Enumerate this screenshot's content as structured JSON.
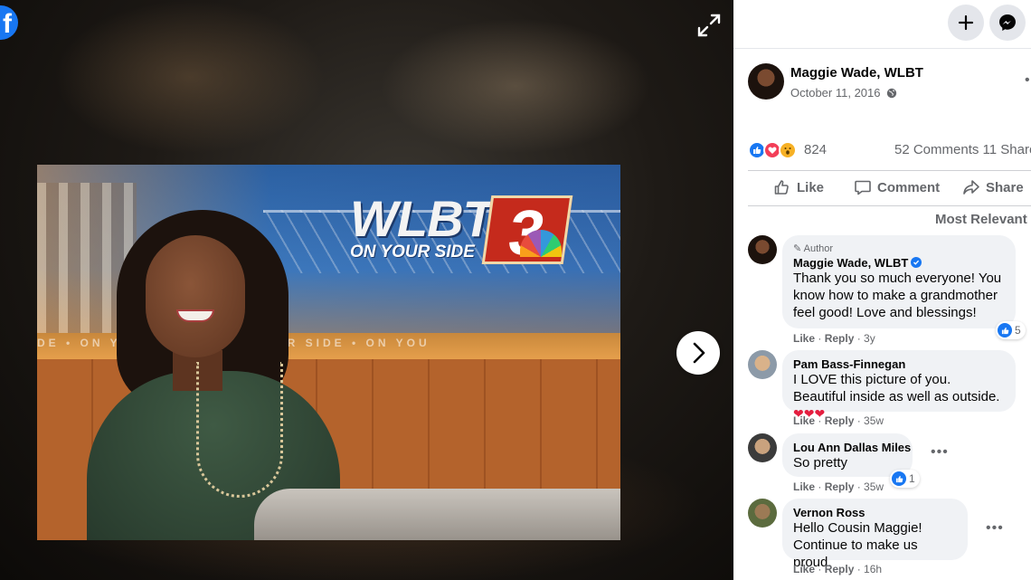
{
  "viewer": {
    "logo_letter": "f",
    "photo": {
      "station_word": "WLBT",
      "station_tagline": "ON YOUR SIDE",
      "channel_number": "3",
      "strip_text": "DE  •  ON YOUR SIDE  •  ON YOUR SIDE  •  ON YOU"
    }
  },
  "post": {
    "author": "Maggie Wade, WLBT",
    "date": "October 11, 2016",
    "more": "•••",
    "reaction_count": "824",
    "comments_shares": "52 Comments  11 Share",
    "actions": {
      "like": "Like",
      "comment": "Comment",
      "share": "Share"
    },
    "sort_label": "Most Relevant"
  },
  "comments": [
    {
      "author_tag": "Author",
      "name": "Maggie Wade, WLBT",
      "text": "Thank you so much everyone! You know how to make a grandmother feel good! Love and blessings!",
      "likes": "5",
      "meta_like": "Like",
      "meta_reply": "Reply",
      "meta_time": "3y"
    },
    {
      "name": "Pam Bass-Finnegan",
      "text": "I LOVE this picture of you. Beautiful inside as well as outside.",
      "emoji": "❤❤❤",
      "meta_like": "Like",
      "meta_reply": "Reply",
      "meta_time": "35w"
    },
    {
      "name": "Lou Ann Dallas Miles",
      "text": "So pretty",
      "likes": "1",
      "meta_like": "Like",
      "meta_reply": "Reply",
      "meta_time": "35w"
    },
    {
      "name": "Vernon Ross",
      "text": "Hello Cousin Maggie! Continue to make us proud.",
      "meta_like": "Like",
      "meta_reply": "Reply",
      "meta_time": "16h"
    }
  ],
  "icons": {
    "plus": "plus-icon",
    "messenger": "messenger-icon",
    "expand": "expand-icon",
    "next": "chevron-right-icon",
    "globe": "globe-icon",
    "like": "thumbs-up-icon",
    "comment": "comment-icon",
    "share": "share-icon"
  },
  "colors": {
    "brand": "#1877f2",
    "text_secondary": "#65676b",
    "bubble": "#f0f2f5",
    "love": "#e41e3f"
  }
}
